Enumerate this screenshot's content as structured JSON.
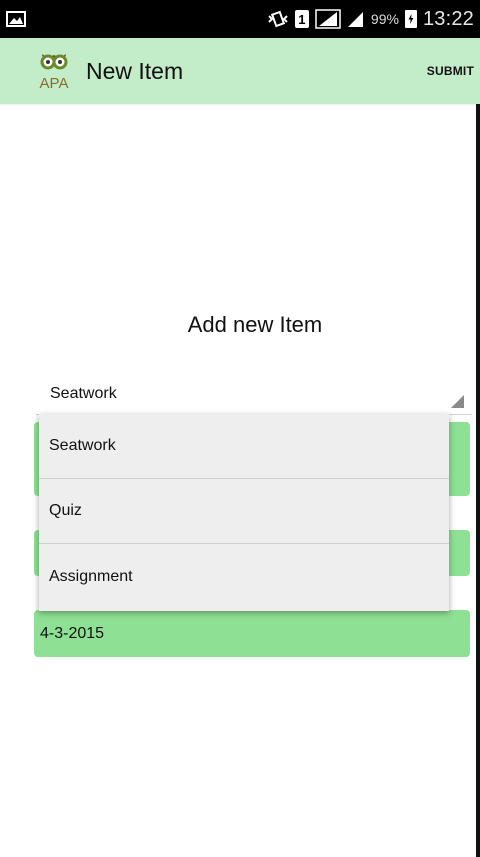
{
  "status_bar": {
    "sim_label": "1",
    "battery": "99%",
    "time": "13:22"
  },
  "toolbar": {
    "logo_text": "APA",
    "title": "New Item",
    "submit_label": "SUBMIT"
  },
  "form": {
    "heading": "Add new Item",
    "type_selected": "Seatwork",
    "date_value": "4-3-2015"
  },
  "dropdown": {
    "options": [
      "Seatwork",
      "Quiz",
      "Assignment"
    ]
  },
  "colors": {
    "toolbar_bg": "#c3ecc8",
    "field_bg": "#8ee094",
    "dropdown_bg": "#eeeeee"
  },
  "icons": [
    "image-icon",
    "vibrate-icon",
    "sim-icon",
    "signal-icon",
    "battery-icon",
    "owl-logo"
  ]
}
